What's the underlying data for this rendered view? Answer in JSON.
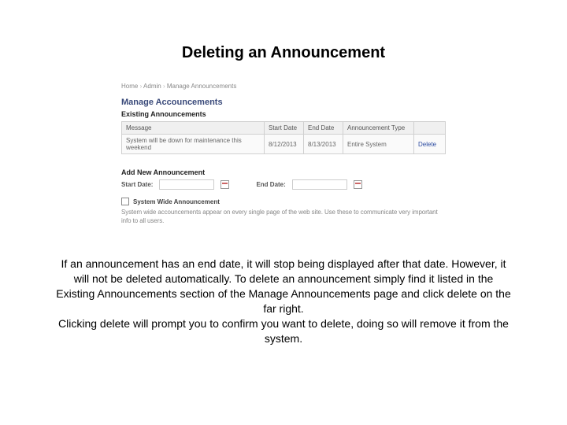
{
  "title": "Deleting an Announcement",
  "screenshot": {
    "breadcrumb": {
      "a": "Home",
      "b": "Admin",
      "c": "Manage Announcements"
    },
    "page_heading": "Manage Accouncements",
    "existing_heading": "Existing Announcements",
    "table": {
      "headers": {
        "message": "Message",
        "start": "Start Date",
        "end": "End Date",
        "type": "Announcement Type",
        "action": ""
      },
      "row": {
        "message": "System will be down for maintenance this weekend",
        "start": "8/12/2013",
        "end": "8/13/2013",
        "type": "Entire System",
        "delete": "Delete"
      }
    },
    "add_heading": "Add New Announcement",
    "form": {
      "start_label": "Start Date:",
      "end_label": "End Date:",
      "syswide_label": "System Wide Announcement",
      "help": "System wide accouncements appear on every single page of the web site. Use these to communicate very important info to all users."
    }
  },
  "body": {
    "p1": "If an announcement has an end date, it will stop being displayed after that date. However, it will not be deleted automatically. To delete an announcement simply find it listed in the Existing Announcements section of the Manage Announcements page and click delete on the far right.",
    "p2": "Clicking delete will prompt you to confirm you want to delete, doing so will remove it from the system."
  }
}
